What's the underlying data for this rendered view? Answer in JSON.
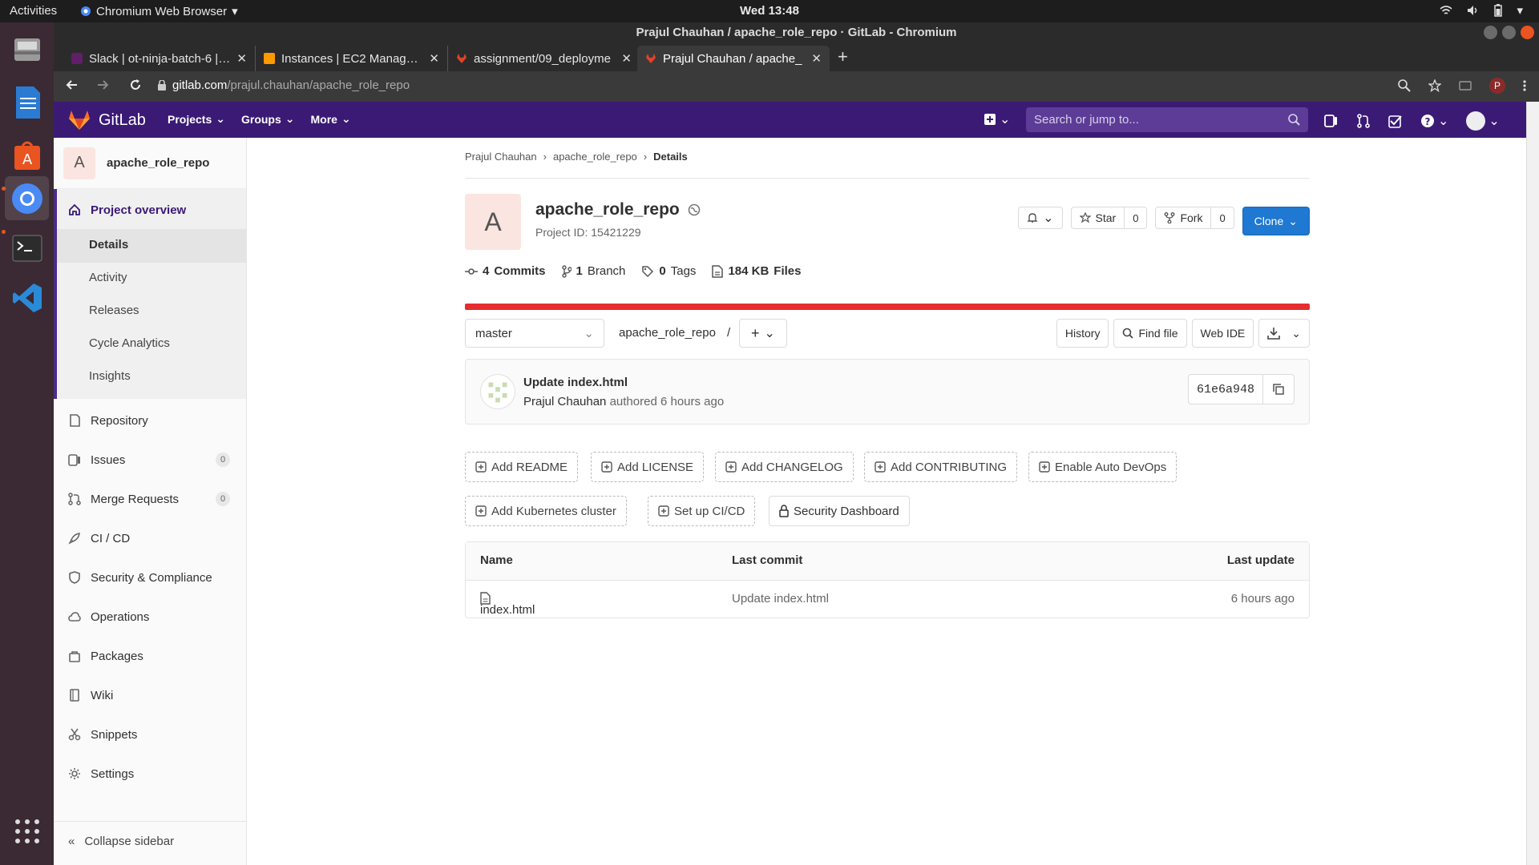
{
  "os": {
    "activities": "Activities",
    "app_name": "Chromium Web Browser",
    "clock": "Wed 13:48"
  },
  "window": {
    "title": "Prajul Chauhan / apache_role_repo · GitLab - Chromium"
  },
  "tabs": [
    {
      "title": "Slack | ot-ninja-batch-6 | O",
      "icon_color": "#611f69"
    },
    {
      "title": "Instances | EC2 Managem",
      "icon_color": "#f90"
    },
    {
      "title": "assignment/09_deployme",
      "icon_color": "#e24329"
    },
    {
      "title": "Prajul Chauhan / apache_",
      "icon_color": "#e24329"
    }
  ],
  "url": {
    "host": "gitlab.com",
    "path": "/prajul.chauhan/apache_role_repo"
  },
  "gitlab": {
    "logo_text": "GitLab",
    "nav": [
      "Projects",
      "Groups",
      "More"
    ],
    "search_placeholder": "Search or jump to..."
  },
  "sidebar": {
    "project_initial": "A",
    "project_name": "apache_role_repo",
    "overview": "Project overview",
    "sub": [
      "Details",
      "Activity",
      "Releases",
      "Cycle Analytics",
      "Insights"
    ],
    "items": [
      {
        "label": "Repository"
      },
      {
        "label": "Issues",
        "count": "0"
      },
      {
        "label": "Merge Requests",
        "count": "0"
      },
      {
        "label": "CI / CD"
      },
      {
        "label": "Security & Compliance"
      },
      {
        "label": "Operations"
      },
      {
        "label": "Packages"
      },
      {
        "label": "Wiki"
      },
      {
        "label": "Snippets"
      },
      {
        "label": "Settings"
      }
    ],
    "collapse": "Collapse sidebar"
  },
  "breadcrumb": [
    "Prajul Chauhan",
    "apache_role_repo",
    "Details"
  ],
  "project": {
    "initial": "A",
    "name": "apache_role_repo",
    "id_text": "Project ID: 15421229",
    "star": "Star",
    "star_count": "0",
    "fork": "Fork",
    "fork_count": "0",
    "clone": "Clone"
  },
  "stats": {
    "commits_n": "4",
    "commits_l": "Commits",
    "branch_n": "1",
    "branch_l": "Branch",
    "tags_n": "0",
    "tags_l": "Tags",
    "files_n": "184 KB",
    "files_l": "Files"
  },
  "repo": {
    "branch": "master",
    "path": "apache_role_repo",
    "sep": "/",
    "history": "History",
    "find_file": "Find file",
    "web_ide": "Web IDE"
  },
  "commit": {
    "title": "Update index.html",
    "author": "Prajul Chauhan",
    "when": "authored 6 hours ago",
    "sha": "61e6a948"
  },
  "quick_actions": [
    "Add README",
    "Add LICENSE",
    "Add CHANGELOG",
    "Add CONTRIBUTING",
    "Enable Auto DevOps",
    "Add Kubernetes cluster",
    "Set up CI/CD",
    "Security Dashboard"
  ],
  "table": {
    "headers": [
      "Name",
      "Last commit",
      "Last update"
    ],
    "rows": [
      {
        "name": "index.html",
        "commit": "Update index.html",
        "updated": "6 hours ago"
      }
    ]
  },
  "colors": {
    "gitlab_header": "#3b1a76",
    "clone_button": "#1f78d1",
    "alert_bar": "#e52c30",
    "dock": "#3b2a33"
  }
}
